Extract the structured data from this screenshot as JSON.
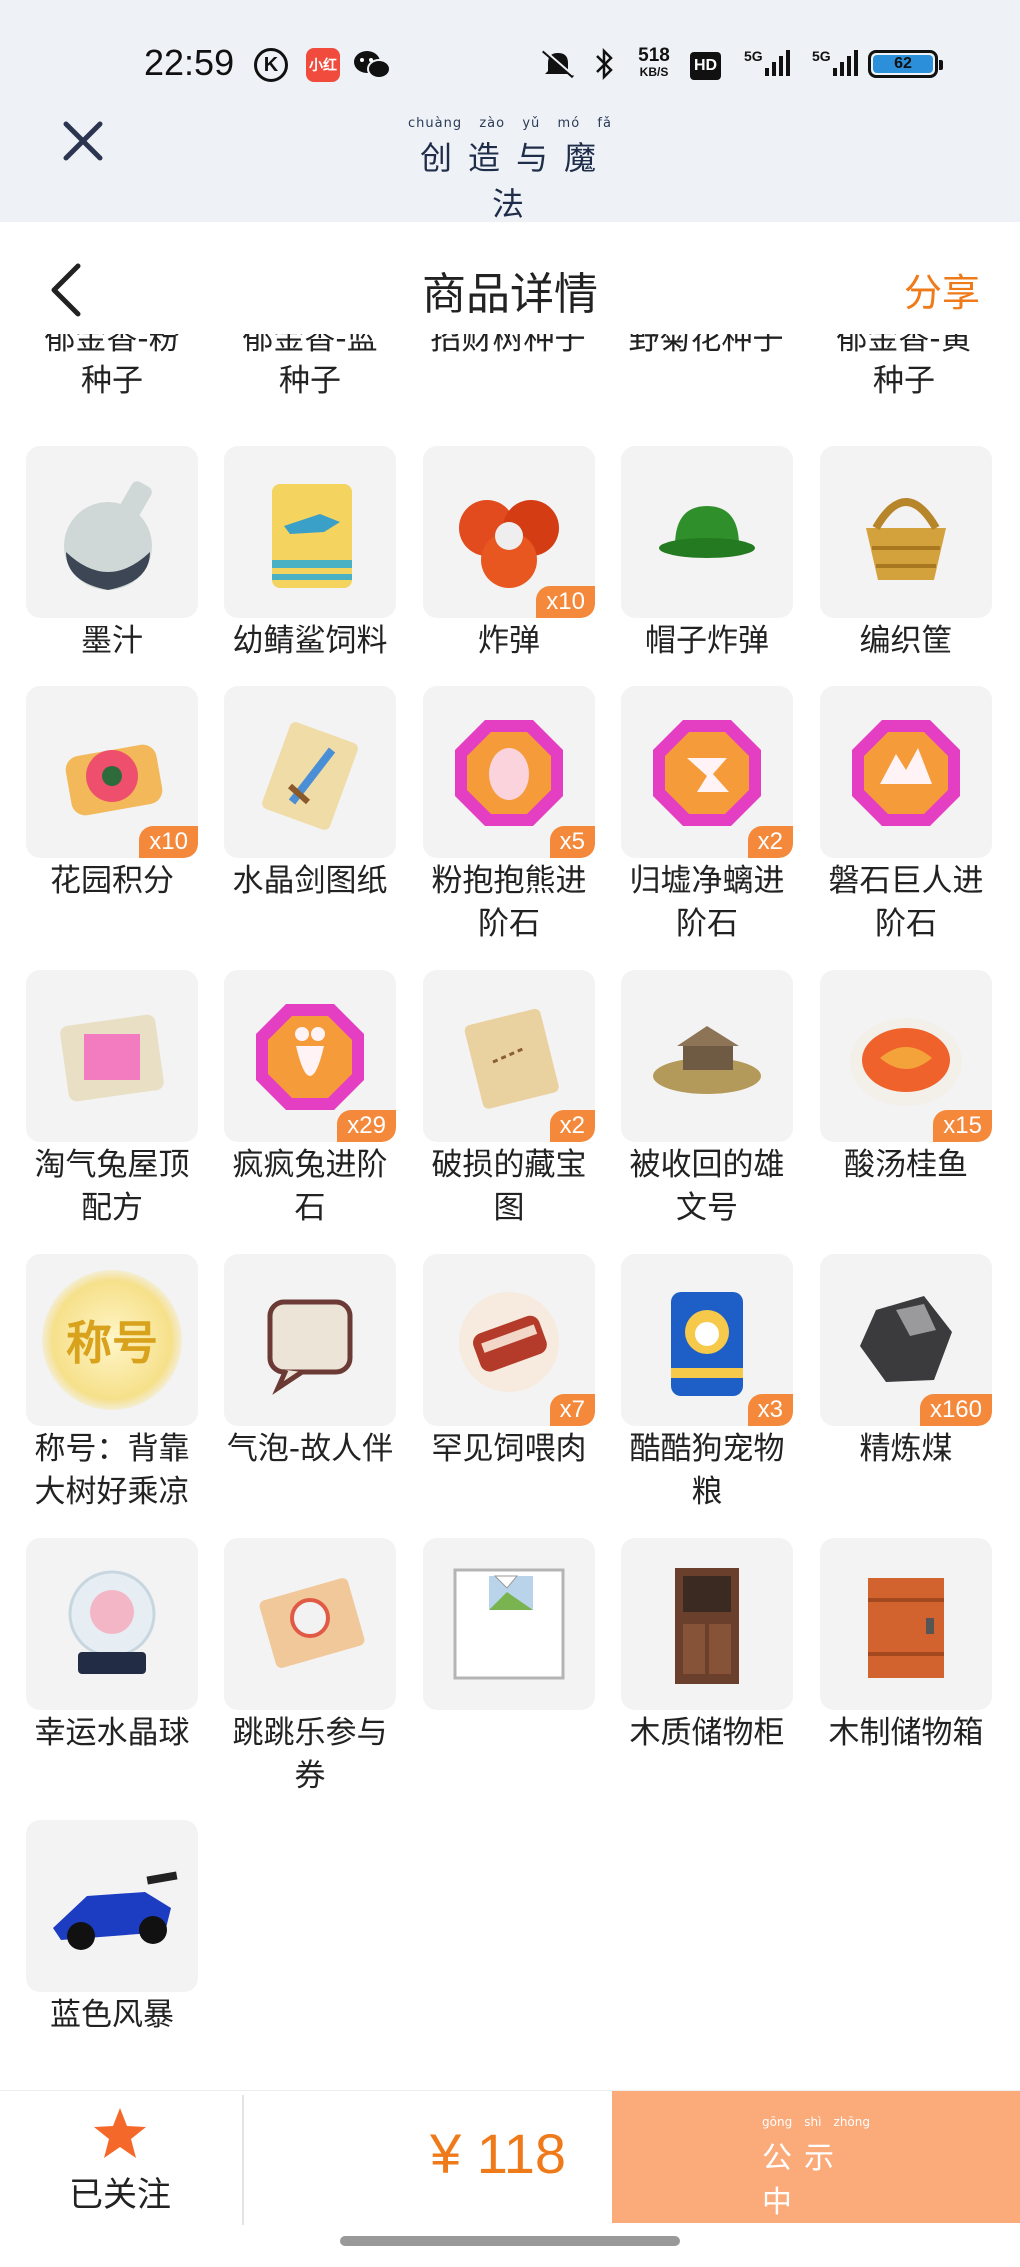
{
  "status_bar": {
    "time": "22:59",
    "k_icon": "K",
    "app_badge": "小红",
    "net_speed": "518",
    "net_unit": "KB/S",
    "hd_label": "HD",
    "signal1": "5G",
    "signal2": "5G",
    "battery": "62"
  },
  "app_header": {
    "title": "创造与魔法",
    "title_chars": [
      "创",
      "造",
      "与",
      "魔",
      "法"
    ],
    "pinyin": [
      "chuàng",
      "zào",
      "yǔ",
      "mó",
      "fǎ"
    ]
  },
  "nav": {
    "title": "商品详情",
    "share": "分享"
  },
  "cut_row": [
    [
      "郁金香-粉",
      "种子"
    ],
    [
      "郁金香-蓝",
      "种子"
    ],
    [
      "招财树种子",
      ""
    ],
    [
      "野菊花种子",
      ""
    ],
    [
      "郁金香-黄",
      "种子"
    ]
  ],
  "items": [
    {
      "name": "墨汁",
      "qty": "",
      "icon": "ink-bottle-icon"
    },
    {
      "name": "幼鲭鲨饲料",
      "qty": "",
      "icon": "shark-feed-bag-icon"
    },
    {
      "name": "炸弹",
      "qty": "x10",
      "icon": "bomb-icon"
    },
    {
      "name": "帽子炸弹",
      "qty": "",
      "icon": "hat-bomb-icon"
    },
    {
      "name": "编织筐",
      "qty": "",
      "icon": "woven-basket-icon"
    },
    {
      "name": "花园积分",
      "qty": "x10",
      "icon": "garden-points-flower-icon"
    },
    {
      "name": "水晶剑图纸",
      "qty": "",
      "icon": "crystal-sword-blueprint-icon"
    },
    {
      "name": "粉抱抱熊进阶石",
      "qty": "x5",
      "icon": "advance-stone-egg-icon"
    },
    {
      "name": "归墟净螭进阶石",
      "qty": "x2",
      "icon": "advance-stone-dragon-icon"
    },
    {
      "name": "磐石巨人进阶石",
      "qty": "",
      "icon": "advance-stone-giant-icon"
    },
    {
      "name": "淘气兔屋顶配方",
      "qty": "",
      "icon": "roof-recipe-icon"
    },
    {
      "name": "疯疯兔进阶石",
      "qty": "x29",
      "icon": "advance-stone-rabbit-icon"
    },
    {
      "name": "破损的藏宝图",
      "qty": "x2",
      "icon": "treasure-map-icon"
    },
    {
      "name": "被收回的雄文号",
      "qty": "",
      "icon": "ruins-icon"
    },
    {
      "name": "酸汤桂鱼",
      "qty": "x15",
      "icon": "fish-soup-icon"
    },
    {
      "name": "称号：背靠大树好乘凉",
      "qty": "",
      "icon": "title-badge-icon",
      "badge_text": "称号"
    },
    {
      "name": "气泡-故人伴",
      "qty": "",
      "icon": "speech-bubble-icon"
    },
    {
      "name": "罕见饲喂肉",
      "qty": "x7",
      "icon": "rare-meat-icon"
    },
    {
      "name": "酷酷狗宠物粮",
      "qty": "x3",
      "icon": "dog-food-bag-icon"
    },
    {
      "name": "精炼煤",
      "qty": "x160",
      "icon": "refined-coal-icon"
    },
    {
      "name": "幸运水晶球",
      "qty": "",
      "icon": "crystal-ball-icon"
    },
    {
      "name": "跳跳乐参与券",
      "qty": "",
      "icon": "ticket-icon"
    },
    {
      "name": "",
      "qty": "",
      "icon": "broken-image-icon"
    },
    {
      "name": "木质储物柜",
      "qty": "",
      "icon": "wooden-cabinet-icon"
    },
    {
      "name": "木制储物箱",
      "qty": "",
      "icon": "wooden-crate-icon"
    },
    {
      "name": "蓝色风暴",
      "qty": "",
      "icon": "blue-race-car-icon"
    }
  ],
  "bottom_bar": {
    "follow_label": "已关注",
    "price": "¥ 118",
    "public_label": "公示中",
    "public_chars": [
      "公",
      "示",
      "中"
    ],
    "public_pinyin": [
      "gōng",
      "shì",
      "zhōng"
    ]
  },
  "colors": {
    "accent": "#ef7a1a",
    "qty_badge": "#f5893b",
    "public_button": "#fbaa7a",
    "header_bg": "#eef2f6"
  }
}
